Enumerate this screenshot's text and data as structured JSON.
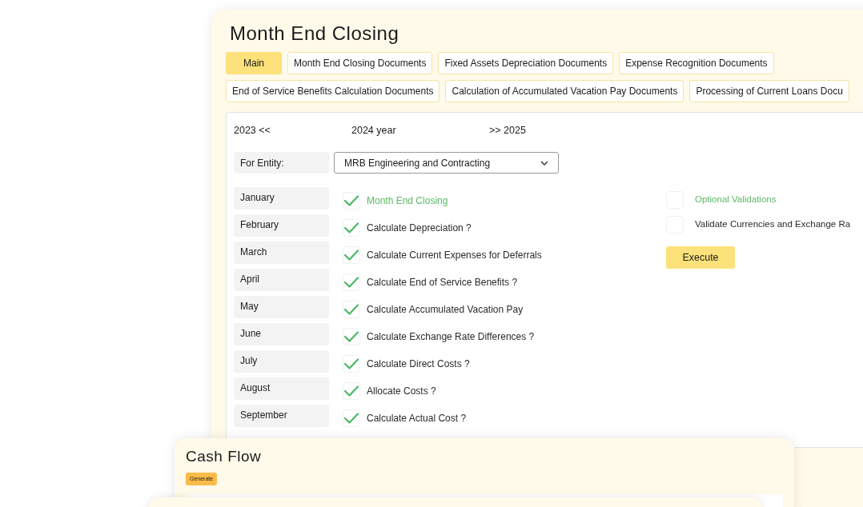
{
  "main_card": {
    "title": "Month End Closing",
    "tabs": [
      {
        "label": "Main",
        "selected": true
      },
      {
        "label": "Month End Closing Documents",
        "selected": false
      },
      {
        "label": "Fixed Assets Depreciation Documents",
        "selected": false
      },
      {
        "label": "Expense Recognition Documents",
        "selected": false
      },
      {
        "label": "End of Service Benefits Calculation Documents",
        "selected": false
      },
      {
        "label": "Calculation of Accumulated Vacation Pay Documents",
        "selected": false
      },
      {
        "label": "Processing of Current Loans Docu",
        "selected": false
      }
    ],
    "year_nav": {
      "previous": "2023 <<",
      "current": "2024 year",
      "next": ">> 2025"
    },
    "entity": {
      "label": "For Entity:",
      "value": "MRB Engineering and Contracting"
    },
    "months": [
      "January",
      "February",
      "March",
      "April",
      "May",
      "June",
      "July",
      "August",
      "September"
    ],
    "tasks": [
      {
        "label": "Month End Closing",
        "kind": "header",
        "checked": true
      },
      {
        "label": "Calculate Depreciation ?",
        "kind": "task",
        "checked": true
      },
      {
        "label": "Calculate Current Expenses for Deferrals",
        "kind": "task",
        "checked": true
      },
      {
        "label": "Calculate End of Service Benefits ?",
        "kind": "task",
        "checked": true
      },
      {
        "label": "Calculate Accumulated Vacation Pay",
        "kind": "task",
        "checked": true
      },
      {
        "label": "Calculate Exchange Rate Differences ?",
        "kind": "task",
        "checked": true
      },
      {
        "label": "Calculate Direct Costs ?",
        "kind": "task",
        "checked": true
      },
      {
        "label": "Allocate Costs ?",
        "kind": "task",
        "checked": true
      },
      {
        "label": "Calculate Actual Cost ?",
        "kind": "task",
        "checked": true
      }
    ],
    "validations": [
      {
        "label": "Optional Validations",
        "kind": "header",
        "checked": false
      },
      {
        "label": "Validate Currencies and Exchange Ra",
        "kind": "task",
        "checked": false
      }
    ],
    "execute_button": "Execute"
  },
  "cash_flow_card": {
    "title": "Cash Flow",
    "generate_button": "Generate"
  }
}
